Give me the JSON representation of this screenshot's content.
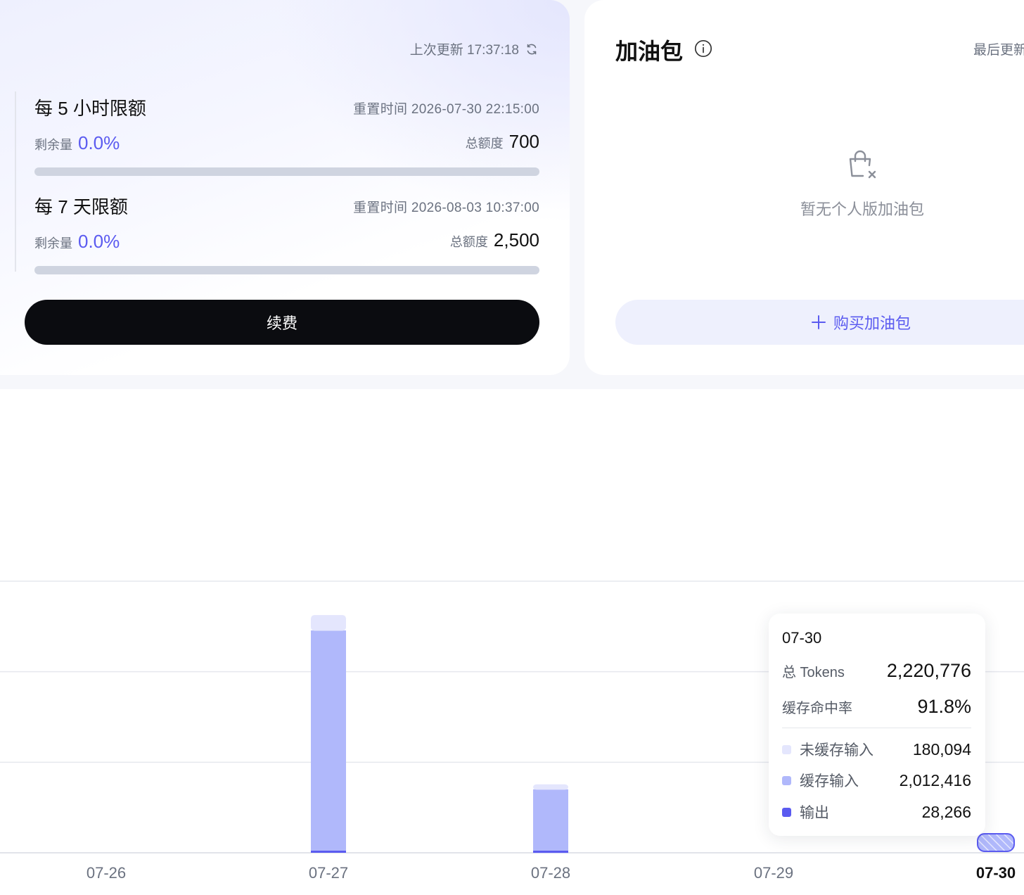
{
  "plan": {
    "last_update_label": "上次更新 17:37:18",
    "quotas": [
      {
        "title": "每 5 小时限额",
        "reset": "重置时间 2026-07-30 22:15:00",
        "remain_label": "剩余量",
        "remain_value": "0.0%",
        "remain_fraction": 0.0,
        "total_label": "总额度",
        "total_value": "700"
      },
      {
        "title": "每 7 天限额",
        "reset": "重置时间 2026-08-03 10:37:00",
        "remain_label": "剩余量",
        "remain_value": "0.0%",
        "remain_fraction": 0.0,
        "total_label": "总额度",
        "total_value": "2,500"
      }
    ],
    "renew_label": "续费"
  },
  "addon": {
    "title": "加油包",
    "last_update_label": "最后更新",
    "empty_text": "暂无个人版加油包",
    "buy_label": "购买加油包"
  },
  "colors": {
    "accent": "#5b5bf0",
    "uncached_input": "#e4e6fd",
    "cached_input": "#b0b8fb",
    "output": "#5b5bf0"
  },
  "chart_data": {
    "type": "bar",
    "stacked": true,
    "categories": [
      "07-26",
      "07-27",
      "07-28",
      "07-29",
      "07-30"
    ],
    "selected_category": "07-30",
    "ylim": [
      0,
      30000000
    ],
    "grid": true,
    "series": [
      {
        "name": "输出",
        "color": "#5b5bf0",
        "values": [
          0,
          60000,
          8000,
          0,
          28266
        ]
      },
      {
        "name": "缓存输入",
        "color": "#b0b8fb",
        "values": [
          0,
          24500000,
          7000000,
          0,
          2012416
        ]
      },
      {
        "name": "未缓存输入",
        "color": "#e4e6fd",
        "values": [
          0,
          1700000,
          550000,
          0,
          180094
        ]
      }
    ]
  },
  "tooltip": {
    "date": "07-30",
    "total_label": "总 Tokens",
    "total_value": "2,220,776",
    "hit_label": "缓存命中率",
    "hit_value": "91.8%",
    "items": [
      {
        "label": "未缓存输入",
        "value": "180,094",
        "color": "#e4e6fd"
      },
      {
        "label": "缓存输入",
        "value": "2,012,416",
        "color": "#b0b8fb"
      },
      {
        "label": "输出",
        "value": "28,266",
        "color": "#5b5bf0"
      }
    ]
  }
}
